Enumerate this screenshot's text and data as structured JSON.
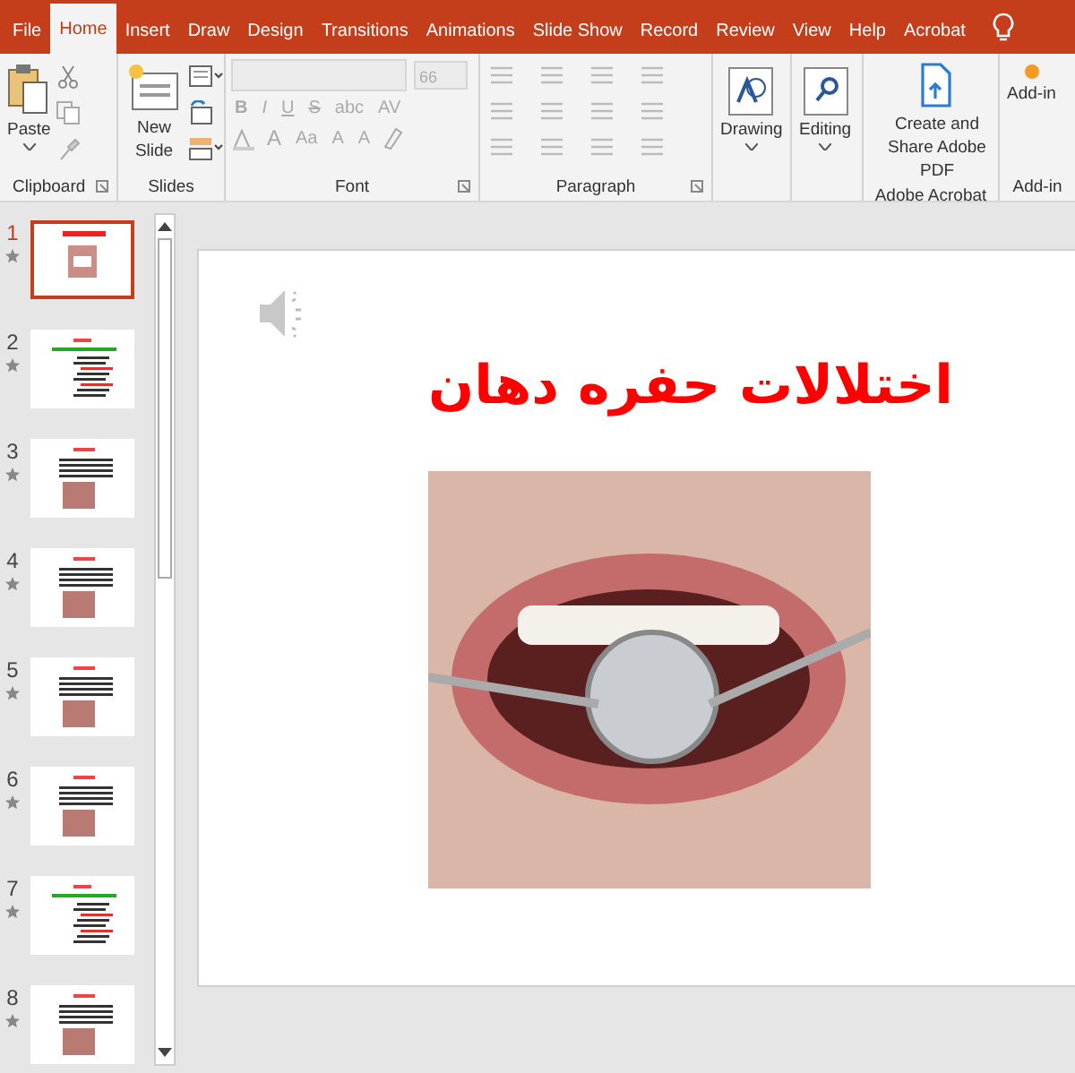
{
  "menu_tabs": [
    {
      "label": "File",
      "selected": false
    },
    {
      "label": "Home",
      "selected": true
    },
    {
      "label": "Insert",
      "selected": false
    },
    {
      "label": "Draw",
      "selected": false
    },
    {
      "label": "Design",
      "selected": false
    },
    {
      "label": "Transitions",
      "selected": false
    },
    {
      "label": "Animations",
      "selected": false
    },
    {
      "label": "Slide Show",
      "selected": false
    },
    {
      "label": "Record",
      "selected": false
    },
    {
      "label": "Review",
      "selected": false
    },
    {
      "label": "View",
      "selected": false
    },
    {
      "label": "Help",
      "selected": false
    },
    {
      "label": "Acrobat",
      "selected": false
    }
  ],
  "ribbon": {
    "groups": [
      {
        "kind": "clipboard",
        "label": "Clipboard",
        "button": "Paste",
        "launcher": true
      },
      {
        "kind": "slides",
        "label": "Slides",
        "button": "New Slide"
      },
      {
        "kind": "font",
        "label": "Font",
        "disabled": true,
        "size": "66",
        "row_1": [
          "B",
          "I",
          "U",
          "S",
          "abc",
          "AV"
        ],
        "row_2": [
          "A",
          "Aa",
          "A",
          "A"
        ],
        "launcher": true
      },
      {
        "kind": "paragraph",
        "label": "Paragraph",
        "disabled": true,
        "launcher": true
      },
      {
        "kind": "drawing",
        "button": "Drawing"
      },
      {
        "kind": "editing",
        "button": "Editing"
      },
      {
        "kind": "acrobat",
        "label": "Adobe Acrobat",
        "button": "Create and Share Adobe PDF"
      },
      {
        "kind": "addins",
        "label": "Add-in",
        "button": "Add-in"
      }
    ]
  },
  "slides": [
    {
      "number": "1",
      "selected": true,
      "animated": true,
      "kind": "title-photo"
    },
    {
      "number": "2",
      "selected": false,
      "animated": true,
      "kind": "text"
    },
    {
      "number": "3",
      "selected": false,
      "animated": true,
      "kind": "text-photo"
    },
    {
      "number": "4",
      "selected": false,
      "animated": true,
      "kind": "text-photo"
    },
    {
      "number": "5",
      "selected": false,
      "animated": true,
      "kind": "text-photo"
    },
    {
      "number": "6",
      "selected": false,
      "animated": true,
      "kind": "text-photo"
    },
    {
      "number": "7",
      "selected": false,
      "animated": true,
      "kind": "text"
    },
    {
      "number": "8",
      "selected": false,
      "animated": true,
      "kind": "text-photo"
    }
  ],
  "slide": {
    "title": "اختلالات حفره دهان",
    "has_audio": true
  }
}
